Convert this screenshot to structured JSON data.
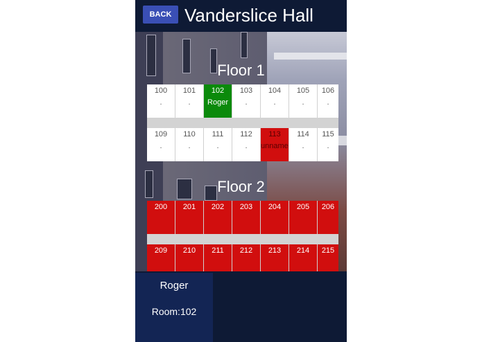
{
  "header": {
    "back_label": "BACK",
    "title": "Vanderslice Hall"
  },
  "floors": [
    {
      "label": "Floor 1",
      "rows": [
        [
          {
            "number": "100",
            "occupant": ".",
            "status": "vacant"
          },
          {
            "number": "101",
            "occupant": ".",
            "status": "vacant"
          },
          {
            "number": "102",
            "occupant": "Roger",
            "status": "selected"
          },
          {
            "number": "103",
            "occupant": ".",
            "status": "vacant"
          },
          {
            "number": "104",
            "occupant": ".",
            "status": "vacant"
          },
          {
            "number": "105",
            "occupant": ".",
            "status": "vacant"
          },
          {
            "number": "106",
            "occupant": ".",
            "status": "vacant"
          }
        ],
        [
          {
            "number": "109",
            "occupant": ".",
            "status": "vacant"
          },
          {
            "number": "110",
            "occupant": ".",
            "status": "vacant"
          },
          {
            "number": "111",
            "occupant": ".",
            "status": "vacant"
          },
          {
            "number": "112",
            "occupant": ".",
            "status": "vacant"
          },
          {
            "number": "113",
            "occupant": "unnamed",
            "status": "occupied"
          },
          {
            "number": "114",
            "occupant": ".",
            "status": "vacant"
          },
          {
            "number": "115",
            "occupant": ".",
            "status": "vacant"
          }
        ]
      ]
    },
    {
      "label": "Floor 2",
      "rows": [
        [
          {
            "number": "200",
            "occupant": "",
            "status": "occupied"
          },
          {
            "number": "201",
            "occupant": "",
            "status": "occupied"
          },
          {
            "number": "202",
            "occupant": "",
            "status": "occupied"
          },
          {
            "number": "203",
            "occupant": "",
            "status": "occupied"
          },
          {
            "number": "204",
            "occupant": "",
            "status": "occupied"
          },
          {
            "number": "205",
            "occupant": "",
            "status": "occupied"
          },
          {
            "number": "206",
            "occupant": "",
            "status": "occupied"
          }
        ],
        [
          {
            "number": "209",
            "occupant": "",
            "status": "occupied"
          },
          {
            "number": "210",
            "occupant": "",
            "status": "occupied"
          },
          {
            "number": "211",
            "occupant": "",
            "status": "occupied"
          },
          {
            "number": "212",
            "occupant": "",
            "status": "occupied"
          },
          {
            "number": "213",
            "occupant": "",
            "status": "occupied"
          },
          {
            "number": "214",
            "occupant": "",
            "status": "occupied"
          },
          {
            "number": "215",
            "occupant": "",
            "status": "occupied"
          }
        ]
      ]
    }
  ],
  "selected": {
    "name": "Roger",
    "room_text": "Room:102"
  },
  "colors": {
    "background": "#0e1a35",
    "back_button": "#3a4fb5",
    "selected_room": "#0b8a0b",
    "occupied_room": "#d10e0e",
    "vacant_room": "#ffffff",
    "info_card": "#132554"
  }
}
